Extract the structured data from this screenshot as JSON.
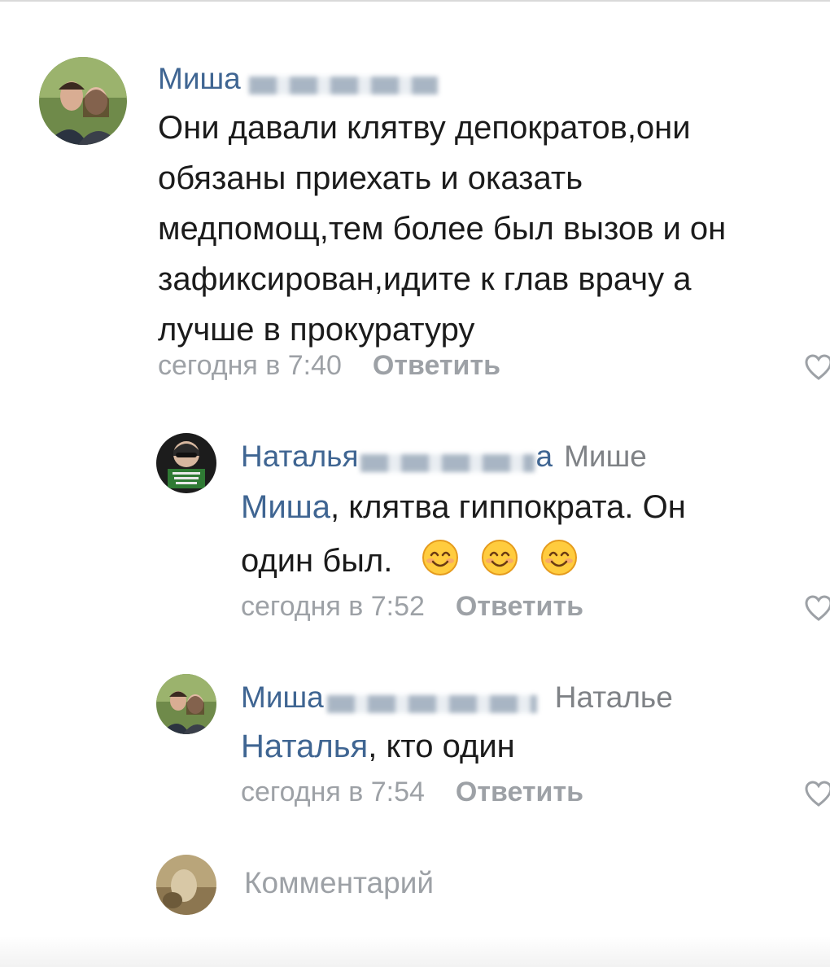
{
  "comments": [
    {
      "author": "Миша",
      "reply_to": "",
      "mention": "",
      "text_lines": [
        "Они давали клятву депократов,они",
        "обязаны приехать и оказать",
        "медпомощ,тем более был вызов и он",
        "зафиксирован,идите к глав врачу а",
        "лучше в прокуратуру"
      ],
      "time": "сегодня в 7:40",
      "reply_label": "Ответить"
    },
    {
      "author": "Наталья",
      "author_suffix": "а",
      "reply_to": "Мише",
      "mention": "Миша",
      "text_after_mention": ", клятва гиппократа. Он",
      "text_line2": "один был.",
      "emoji_count": 3,
      "time": "сегодня в 7:52",
      "reply_label": "Ответить"
    },
    {
      "author": "Миша",
      "reply_to": "Наталье",
      "mention": "Наталья",
      "text_after_mention": ", кто один",
      "time": "сегодня в 7:54",
      "reply_label": "Ответить"
    }
  ],
  "composer": {
    "placeholder": "Комментарий"
  },
  "icons": {
    "like": "heart-outline-icon",
    "emoji": "smiling-face-emoji"
  },
  "colors": {
    "author": "#3f6592",
    "text": "#1b1b1b",
    "meta": "#9da1a6"
  }
}
